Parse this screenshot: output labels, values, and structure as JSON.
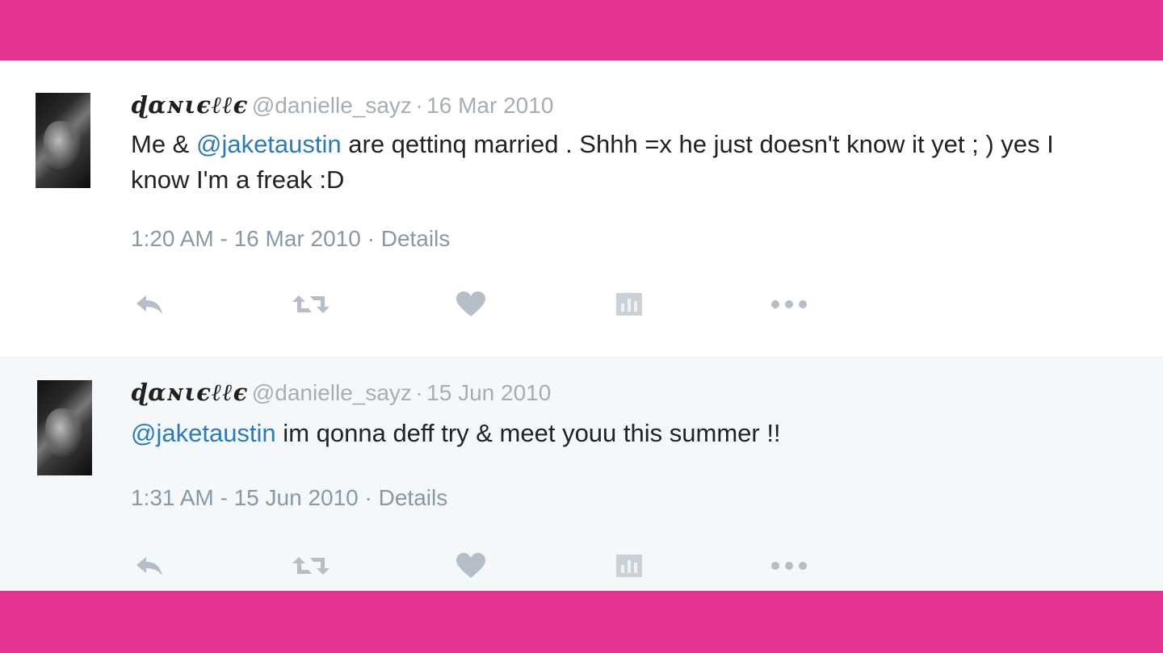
{
  "colors": {
    "frame": "#e2338f",
    "mention": "#2b7bb9",
    "muted": "#8899a6"
  },
  "tweets": [
    {
      "display_name": "ɖαɴιєℓℓє",
      "handle": "@danielle_sayz",
      "separator": "·",
      "date": "16 Mar 2010",
      "text_parts": [
        "Me & ",
        "@jaketaustin",
        " are qettinq married . Shhh =x he just doesn't know it yet ; ) yes I know I'm a freak :D"
      ],
      "timestamp": "1:20 AM - 16 Mar 2010",
      "details_label": "Details",
      "icons": [
        "reply-icon",
        "retweet-icon",
        "like-icon",
        "analytics-icon",
        "more-icon"
      ]
    },
    {
      "display_name": "ɖαɴιєℓℓє",
      "handle": "@danielle_sayz",
      "separator": "·",
      "date": "15 Jun 2010",
      "text_parts": [
        "",
        "@jaketaustin",
        " im qonna deff try & meet youu this summer !!"
      ],
      "timestamp": "1:31 AM - 15 Jun 2010",
      "details_label": "Details",
      "icons": [
        "reply-icon",
        "retweet-icon",
        "like-icon",
        "analytics-icon",
        "more-icon"
      ]
    }
  ]
}
